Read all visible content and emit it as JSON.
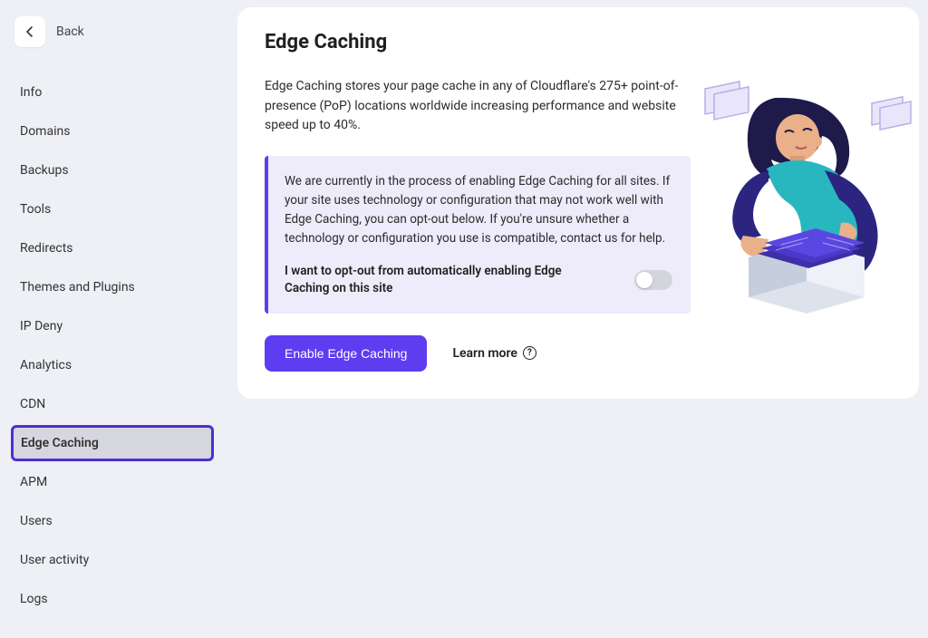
{
  "sidebar": {
    "back_label": "Back",
    "items": [
      {
        "label": "Info"
      },
      {
        "label": "Domains"
      },
      {
        "label": "Backups"
      },
      {
        "label": "Tools"
      },
      {
        "label": "Redirects"
      },
      {
        "label": "Themes and Plugins"
      },
      {
        "label": "IP Deny"
      },
      {
        "label": "Analytics"
      },
      {
        "label": "CDN"
      },
      {
        "label": "Edge Caching",
        "active": true
      },
      {
        "label": "APM"
      },
      {
        "label": "Users"
      },
      {
        "label": "User activity"
      },
      {
        "label": "Logs"
      }
    ]
  },
  "main": {
    "title": "Edge Caching",
    "description": "Edge Caching stores your page cache in any of Cloudflare's 275+ point-of-presence (PoP) locations worldwide increasing performance and website speed up to 40%.",
    "notice_text": "We are currently in the process of enabling Edge Caching for all sites. If your site uses technology or configuration that may not work well with Edge Caching, you can opt-out below. If you're unsure whether a technology or configuration you use is compatible, contact us for help.",
    "optout_label": "I want to opt-out from automatically enabling Edge Caching on this site",
    "enable_button": "Enable Edge Caching",
    "learn_more": "Learn more"
  }
}
